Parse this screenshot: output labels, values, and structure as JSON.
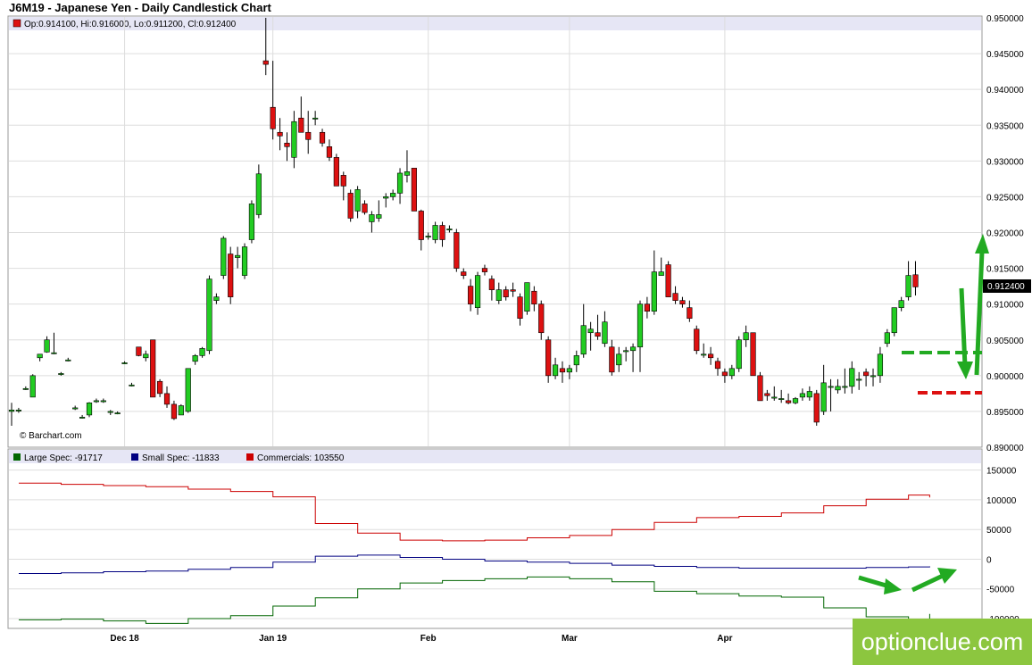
{
  "title": "J6M19 - Japanese Yen - Daily Candlestick Chart",
  "ohlc_label": "Op:0.914100, Hi:0.916000, Lo:0.911200, Cl:0.912400",
  "copyright": "© Barchart.com",
  "watermark": "optionclue.com",
  "last_price_label": "0.912400",
  "colors": {
    "up": "#22cc22",
    "down": "#dd1111",
    "large": "#006600",
    "small": "#000080",
    "comm": "#cc0000",
    "arrow": "#22aa22",
    "dash_red": "#dd1111"
  },
  "chart_data": [
    {
      "type": "candlestick",
      "ylim": [
        0.89,
        0.95
      ],
      "yticks": [
        "0.950000",
        "0.945000",
        "0.940000",
        "0.935000",
        "0.930000",
        "0.925000",
        "0.920000",
        "0.915000",
        "0.910000",
        "0.905000",
        "0.900000",
        "0.895000",
        "0.890000"
      ],
      "xticks": [
        {
          "label": "Dec 18",
          "index": 16
        },
        {
          "label": "Jan 19",
          "index": 37
        },
        {
          "label": "Feb",
          "index": 59
        },
        {
          "label": "Mar",
          "index": 79
        },
        {
          "label": "Apr",
          "index": 101
        }
      ],
      "candles": [
        [
          0.895,
          0.8962,
          0.893,
          0.8952
        ],
        [
          0.8952,
          0.8955,
          0.8948,
          0.8952
        ],
        [
          0.8982,
          0.8985,
          0.898,
          0.8982
        ],
        [
          0.897,
          0.9002,
          0.897,
          0.9
        ],
        [
          0.9025,
          0.903,
          0.902,
          0.903
        ],
        [
          0.9033,
          0.9055,
          0.9032,
          0.905
        ],
        [
          0.9032,
          0.906,
          0.903,
          0.9032
        ],
        [
          0.9003,
          0.9005,
          0.9,
          0.9003
        ],
        [
          0.9022,
          0.9025,
          0.902,
          0.9022
        ],
        [
          0.8955,
          0.8958,
          0.8952,
          0.8955
        ],
        [
          0.8942,
          0.8945,
          0.894,
          0.8942
        ],
        [
          0.8945,
          0.8963,
          0.8942,
          0.8962
        ],
        [
          0.8965,
          0.8968,
          0.8962,
          0.8965
        ],
        [
          0.8965,
          0.8968,
          0.8962,
          0.8965
        ],
        [
          0.895,
          0.8952,
          0.8945,
          0.895
        ],
        [
          0.8948,
          0.895,
          0.8946,
          0.8948
        ],
        [
          0.9018,
          0.902,
          0.9016,
          0.9018
        ],
        [
          0.8987,
          0.899,
          0.8985,
          0.8987
        ],
        [
          0.904,
          0.904,
          0.9027,
          0.9028
        ],
        [
          0.9025,
          0.9035,
          0.902,
          0.903
        ],
        [
          0.905,
          0.905,
          0.897,
          0.897
        ],
        [
          0.8992,
          0.8995,
          0.897,
          0.8975
        ],
        [
          0.8975,
          0.8985,
          0.8955,
          0.896
        ],
        [
          0.896,
          0.8965,
          0.8938,
          0.894
        ],
        [
          0.8945,
          0.896,
          0.8945,
          0.8958
        ],
        [
          0.895,
          0.901,
          0.8948,
          0.901
        ],
        [
          0.902,
          0.903,
          0.9015,
          0.9028
        ],
        [
          0.9028,
          0.904,
          0.9025,
          0.9038
        ],
        [
          0.9035,
          0.914,
          0.903,
          0.9135
        ],
        [
          0.9105,
          0.9115,
          0.91,
          0.911
        ],
        [
          0.914,
          0.9195,
          0.9135,
          0.9192
        ],
        [
          0.917,
          0.918,
          0.91,
          0.911
        ],
        [
          0.9165,
          0.918,
          0.915,
          0.9168
        ],
        [
          0.914,
          0.9185,
          0.9135,
          0.918
        ],
        [
          0.919,
          0.9245,
          0.9185,
          0.924
        ],
        [
          0.9225,
          0.9295,
          0.922,
          0.9282
        ],
        [
          0.944,
          0.95,
          0.942,
          0.9435
        ],
        [
          0.9375,
          0.944,
          0.933,
          0.9345
        ],
        [
          0.934,
          0.936,
          0.9315,
          0.9335
        ],
        [
          0.9325,
          0.934,
          0.93,
          0.932
        ],
        [
          0.9305,
          0.937,
          0.929,
          0.9355
        ],
        [
          0.936,
          0.939,
          0.934,
          0.934
        ],
        [
          0.934,
          0.937,
          0.931,
          0.933
        ],
        [
          0.936,
          0.937,
          0.935,
          0.936
        ],
        [
          0.934,
          0.9345,
          0.932,
          0.9325
        ],
        [
          0.932,
          0.933,
          0.93,
          0.9305
        ],
        [
          0.9305,
          0.931,
          0.9265,
          0.9265
        ],
        [
          0.928,
          0.9285,
          0.9245,
          0.9265
        ],
        [
          0.9255,
          0.926,
          0.9215,
          0.922
        ],
        [
          0.923,
          0.9265,
          0.922,
          0.926
        ],
        [
          0.924,
          0.9245,
          0.9225,
          0.9228
        ],
        [
          0.9215,
          0.923,
          0.92,
          0.9225
        ],
        [
          0.922,
          0.9245,
          0.9215,
          0.9225
        ],
        [
          0.9248,
          0.9255,
          0.9235,
          0.925
        ],
        [
          0.925,
          0.926,
          0.9245,
          0.9255
        ],
        [
          0.9255,
          0.929,
          0.924,
          0.9283
        ],
        [
          0.928,
          0.9315,
          0.927,
          0.9285
        ],
        [
          0.929,
          0.929,
          0.923,
          0.923
        ],
        [
          0.923,
          0.9232,
          0.9175,
          0.919
        ],
        [
          0.9195,
          0.92,
          0.919,
          0.9195
        ],
        [
          0.919,
          0.9215,
          0.9185,
          0.921
        ],
        [
          0.921,
          0.9215,
          0.918,
          0.919
        ],
        [
          0.9205,
          0.921,
          0.92,
          0.9205
        ],
        [
          0.92,
          0.9205,
          0.9145,
          0.915
        ],
        [
          0.9145,
          0.915,
          0.9135,
          0.914
        ],
        [
          0.9125,
          0.9135,
          0.909,
          0.91
        ],
        [
          0.9095,
          0.9145,
          0.9085,
          0.914
        ],
        [
          0.915,
          0.9155,
          0.914,
          0.9145
        ],
        [
          0.9135,
          0.914,
          0.9105,
          0.912
        ],
        [
          0.9105,
          0.913,
          0.91,
          0.912
        ],
        [
          0.912,
          0.9125,
          0.9105,
          0.911
        ],
        [
          0.912,
          0.913,
          0.911,
          0.9118
        ],
        [
          0.911,
          0.9115,
          0.907,
          0.908
        ],
        [
          0.909,
          0.913,
          0.9085,
          0.913
        ],
        [
          0.9118,
          0.9125,
          0.909,
          0.91
        ],
        [
          0.91,
          0.9105,
          0.905,
          0.906
        ],
        [
          0.905,
          0.9055,
          0.899,
          0.9
        ],
        [
          0.9,
          0.9025,
          0.8995,
          0.9015
        ],
        [
          0.901,
          0.902,
          0.899,
          0.9005
        ],
        [
          0.9005,
          0.9015,
          0.8995,
          0.901
        ],
        [
          0.9015,
          0.9035,
          0.9005,
          0.9028
        ],
        [
          0.903,
          0.91,
          0.9025,
          0.907
        ],
        [
          0.906,
          0.9075,
          0.9035,
          0.9065
        ],
        [
          0.906,
          0.9085,
          0.905,
          0.9055
        ],
        [
          0.9045,
          0.909,
          0.904,
          0.9075
        ],
        [
          0.904,
          0.905,
          0.9,
          0.9005
        ],
        [
          0.9015,
          0.904,
          0.9005,
          0.903
        ],
        [
          0.9035,
          0.904,
          0.902,
          0.9035
        ],
        [
          0.9035,
          0.9045,
          0.9005,
          0.904
        ],
        [
          0.904,
          0.9105,
          0.9005,
          0.91
        ],
        [
          0.91,
          0.911,
          0.908,
          0.909
        ],
        [
          0.909,
          0.9175,
          0.9085,
          0.9145
        ],
        [
          0.914,
          0.9165,
          0.914,
          0.9145
        ],
        [
          0.9155,
          0.916,
          0.911,
          0.911
        ],
        [
          0.9115,
          0.9125,
          0.91,
          0.9105
        ],
        [
          0.9105,
          0.911,
          0.9095,
          0.91
        ],
        [
          0.9095,
          0.9105,
          0.9075,
          0.908
        ],
        [
          0.9065,
          0.907,
          0.903,
          0.9035
        ],
        [
          0.903,
          0.9045,
          0.9025,
          0.903
        ],
        [
          0.903,
          0.904,
          0.9015,
          0.9025
        ],
        [
          0.902,
          0.9025,
          0.9,
          0.901
        ],
        [
          0.9005,
          0.901,
          0.899,
          0.9
        ],
        [
          0.9,
          0.9015,
          0.8995,
          0.901
        ],
        [
          0.901,
          0.9055,
          0.9005,
          0.905
        ],
        [
          0.905,
          0.907,
          0.904,
          0.906
        ],
        [
          0.906,
          0.906,
          0.9,
          0.9
        ],
        [
          0.9,
          0.9005,
          0.8965,
          0.8965
        ],
        [
          0.8975,
          0.898,
          0.8965,
          0.8972
        ],
        [
          0.897,
          0.8985,
          0.8965,
          0.897
        ],
        [
          0.8968,
          0.898,
          0.8962,
          0.8968
        ],
        [
          0.8965,
          0.8975,
          0.896,
          0.8962
        ],
        [
          0.8962,
          0.897,
          0.896,
          0.8968
        ],
        [
          0.897,
          0.8982,
          0.8965,
          0.8975
        ],
        [
          0.897,
          0.8985,
          0.8965,
          0.8978
        ],
        [
          0.8975,
          0.898,
          0.893,
          0.8935
        ],
        [
          0.895,
          0.9015,
          0.8945,
          0.899
        ],
        [
          0.8985,
          0.8995,
          0.895,
          0.8985
        ],
        [
          0.898,
          0.8995,
          0.8975,
          0.8985
        ],
        [
          0.8985,
          0.901,
          0.8975,
          0.8985
        ],
        [
          0.8985,
          0.902,
          0.8975,
          0.901
        ],
        [
          0.8995,
          0.9005,
          0.898,
          0.8995
        ],
        [
          0.9005,
          0.901,
          0.8985,
          0.9
        ],
        [
          0.9,
          0.901,
          0.8985,
          0.9
        ],
        [
          0.9,
          0.904,
          0.899,
          0.903
        ],
        [
          0.9045,
          0.9065,
          0.904,
          0.906
        ],
        [
          0.906,
          0.9095,
          0.9055,
          0.9095
        ],
        [
          0.9095,
          0.911,
          0.909,
          0.9105
        ],
        [
          0.911,
          0.916,
          0.9105,
          0.914
        ],
        [
          0.9141,
          0.916,
          0.9112,
          0.9124
        ]
      ]
    },
    {
      "type": "line",
      "ylim": [
        -115000,
        160000
      ],
      "yticks": [
        "150000",
        "100000",
        "50000",
        "0",
        "-50000",
        "-100000"
      ],
      "legend": [
        "Large Spec: -91717",
        "Small Spec: -11833",
        "Commercials: 103550"
      ],
      "x": [
        0,
        6,
        12,
        18,
        24,
        30,
        36,
        42,
        48,
        54,
        60,
        66,
        72,
        78,
        84,
        90,
        96,
        102,
        108,
        114,
        120,
        126,
        129
      ],
      "series": [
        {
          "name": "Large Spec",
          "values": [
            -102000,
            -101000,
            -104000,
            -108000,
            -100000,
            -95000,
            -79000,
            -65000,
            -50000,
            -40000,
            -36000,
            -33000,
            -30000,
            -33000,
            -38000,
            -54000,
            -58000,
            -62000,
            -64000,
            -82000,
            -97000,
            -101000,
            -92000
          ]
        },
        {
          "name": "Small Spec",
          "values": [
            -24000,
            -23000,
            -21000,
            -20000,
            -17000,
            -14000,
            -5000,
            5000,
            7000,
            3000,
            0,
            -3000,
            -5000,
            -7000,
            -10000,
            -12000,
            -14000,
            -15000,
            -15000,
            -15000,
            -14000,
            -13000,
            -12000
          ]
        },
        {
          "name": "Commercials",
          "values": [
            128000,
            126000,
            124000,
            122000,
            118000,
            114000,
            105000,
            60000,
            44000,
            32000,
            31000,
            32000,
            36000,
            40000,
            50000,
            62000,
            70000,
            72000,
            78000,
            90000,
            101000,
            108000,
            104000
          ]
        }
      ]
    }
  ]
}
